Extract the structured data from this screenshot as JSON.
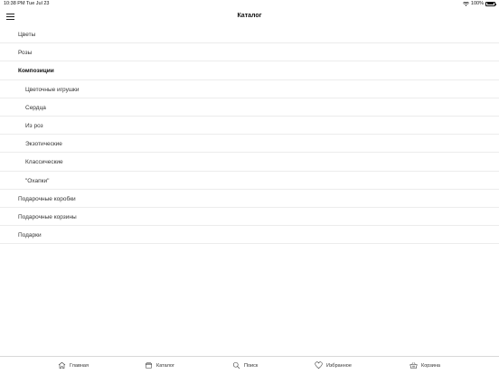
{
  "status": {
    "time": "10:38 PM",
    "date": "Tue Jul 23",
    "battery": "100%"
  },
  "nav": {
    "title": "Каталог"
  },
  "catalog": [
    {
      "label": "Цветы",
      "level": 0,
      "bold": false
    },
    {
      "label": "Розы",
      "level": 0,
      "bold": false
    },
    {
      "label": "Композиции",
      "level": 0,
      "bold": true
    },
    {
      "label": "Цветочные игрушки",
      "level": 1,
      "bold": false
    },
    {
      "label": "Сердца",
      "level": 1,
      "bold": false
    },
    {
      "label": "Из роз",
      "level": 1,
      "bold": false
    },
    {
      "label": "Экзотические",
      "level": 1,
      "bold": false
    },
    {
      "label": "Классические",
      "level": 1,
      "bold": false
    },
    {
      "label": "\"Охапки\"",
      "level": 1,
      "bold": false
    },
    {
      "label": "Подарочные коробки",
      "level": 0,
      "bold": false
    },
    {
      "label": "Подарочные корзины",
      "level": 0,
      "bold": false
    },
    {
      "label": "Подарки",
      "level": 0,
      "bold": false
    }
  ],
  "tabs": [
    {
      "label": "Главная",
      "icon": "home-icon"
    },
    {
      "label": "Каталог",
      "icon": "catalog-icon"
    },
    {
      "label": "Поиск",
      "icon": "search-icon"
    },
    {
      "label": "Избранное",
      "icon": "heart-icon"
    },
    {
      "label": "Корзина",
      "icon": "basket-icon"
    }
  ]
}
